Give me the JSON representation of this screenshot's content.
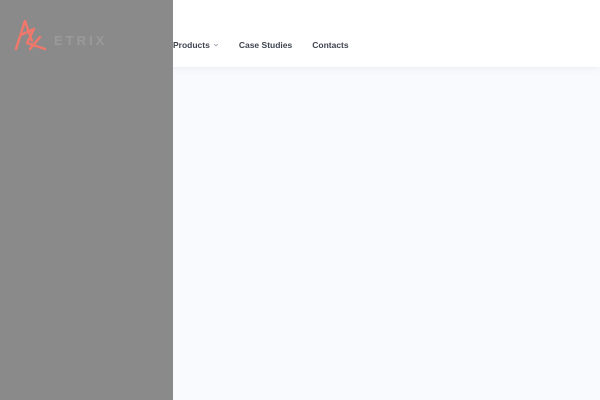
{
  "header": {
    "logo_text": "ETRIX",
    "nav": [
      {
        "label": "Products",
        "has_dropdown": true
      },
      {
        "label": "Case Studies",
        "has_dropdown": false
      },
      {
        "label": "Contacts",
        "has_dropdown": false
      }
    ]
  },
  "colors": {
    "brand_accent": "#f2776b",
    "overlay": "#8a8a8a",
    "nav_text": "#3f4450",
    "page_background": "#f9fafe"
  },
  "icons": {
    "logo": "triangle-logo-icon",
    "dropdown": "chevron-down-icon"
  }
}
